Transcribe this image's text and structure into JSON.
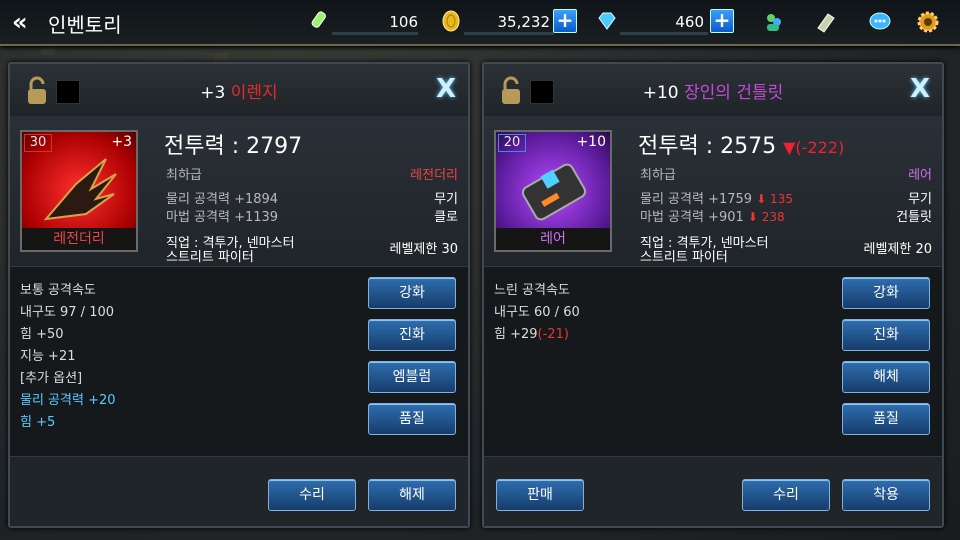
{
  "topbar": {
    "back_icon": "«",
    "title": "인벤토리",
    "resources": [
      {
        "name": "energy",
        "value": "106"
      },
      {
        "name": "gold",
        "value": "35,232"
      },
      {
        "name": "gem",
        "value": "460"
      }
    ],
    "plus": "+"
  },
  "left": {
    "title_prefix": "+3",
    "title_name": "이렌지",
    "title_color": "#e42b2b",
    "level": "30",
    "enhance": "+3",
    "grade_name": "레전더리",
    "grade_color": "#e44",
    "power_label": "전투력 : 2797",
    "power_delta": "",
    "grade_low": "최하급",
    "grade_right": "레전더리",
    "stat1_label": "물리 공격력 +1894",
    "stat1_drop": "",
    "stat1_type": "무기",
    "stat2_label": "마법 공격력 +1139",
    "stat2_drop": "",
    "stat2_type": "클로",
    "job_line1": "직업 : 격투가, 넨마스터",
    "job_line2": "스트리트 파이터",
    "level_limit": "레벨제한 30",
    "lines": [
      "보통 공격속도",
      "내구도 97 / 100",
      "힘 +50",
      "지능 +21",
      "[추가 옵션]",
      "물리 공격력 +20",
      "힘 +5"
    ],
    "buttons": [
      "강화",
      "진화",
      "엠블럼",
      "품질"
    ],
    "footer": [
      "수리",
      "해제"
    ]
  },
  "right": {
    "title_prefix": "+10",
    "title_name": "장인의 건틀릿",
    "title_color": "#c34bd8",
    "level": "20",
    "enhance": "+10",
    "grade_name": "레어",
    "grade_color": "#d070f0",
    "power_label": "전투력 : 2575",
    "power_delta": "▼(-222)",
    "grade_low": "최하급",
    "grade_right": "레어",
    "stat1_label": "물리 공격력 +1759",
    "stat1_drop": "⬇ 135",
    "stat1_type": "무기",
    "stat2_label": "마법 공격력 +901",
    "stat2_drop": "⬇ 238",
    "stat2_type": "건틀릿",
    "job_line1": "직업 : 격투가, 넨마스터",
    "job_line2": "스트리트 파이터",
    "level_limit": "레벨제한 20",
    "lines": [
      "느린 공격속도",
      "내구도 60 / 60",
      "힘 +29"
    ],
    "str_delta": "(-21)",
    "buttons": [
      "강화",
      "진화",
      "해체",
      "품질"
    ],
    "footer": [
      "판매",
      "수리",
      "착용"
    ]
  },
  "close_label": "X"
}
